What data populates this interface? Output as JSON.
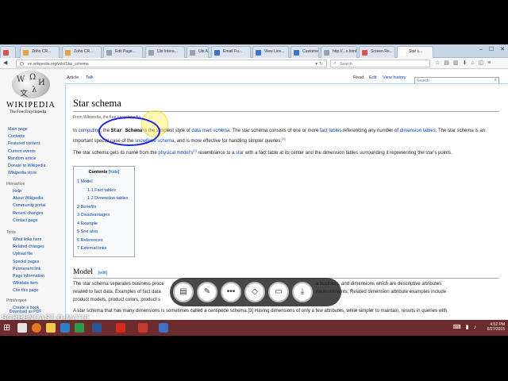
{
  "browser": {
    "tabs": [
      {
        "label": "",
        "color": "#d9534f"
      },
      {
        "label": "Zoho CR...",
        "color": "#e5a33a"
      },
      {
        "label": "Zoho CR...",
        "color": "#e5a33a"
      },
      {
        "label": "Edit Page...",
        "color": "#9aa3ad"
      },
      {
        "label": "Ubi Intera...",
        "color": "#9aa3ad"
      },
      {
        "label": "Ubi Annot...",
        "color": "#9aa3ad"
      },
      {
        "label": "Email Fu...",
        "color": "#3b74c6"
      },
      {
        "label": "View Lice...",
        "color": "#3b74c6"
      },
      {
        "label": "Custome...",
        "color": "#3b74c6"
      },
      {
        "label": "http://...x.html",
        "color": "#9aa3ad"
      },
      {
        "label": "Screen Re...",
        "color": "#d9534f"
      },
      {
        "label": "Star s...",
        "color": "#ffffff"
      }
    ],
    "url": "en.wikipedia.org/wiki/Star_schema",
    "search_placeholder": "Search"
  },
  "wiki": {
    "logo_name": "Wikipedia",
    "logo_tagline": "The Free Encyclopedia",
    "nav_main": [
      "Main page",
      "Contents",
      "Featured content",
      "Current events",
      "Random article",
      "Donate to Wikipedia",
      "Wikipedia store"
    ],
    "interaction_head": "Interaction",
    "nav_interaction": [
      "Help",
      "About Wikipedia",
      "Community portal",
      "Recent changes",
      "Contact page"
    ],
    "tools_head": "Tools",
    "nav_tools": [
      "What links here",
      "Related changes",
      "Upload file",
      "Special pages",
      "Permanent link",
      "Page information",
      "Wikidata item",
      "Cite this page"
    ],
    "print_head": "Print/export",
    "nav_print": [
      "Create a book",
      "Download as PDF"
    ],
    "tab_article": "Article",
    "tab_talk": "Talk",
    "tab_read": "Read",
    "tab_edit": "Edit",
    "tab_history": "View history",
    "search_placeholder": "Search",
    "title": "Star schema",
    "from": "From Wikipedia, the free encyclopedia",
    "intro": {
      "p1_a": "In ",
      "p1_link1": "computing",
      "p1_b": ", the ",
      "p1_term": "Star Schema",
      "p1_c": " is the simplest style of ",
      "p1_link2": "data mart schema",
      "p1_d": ". The star schema consists of one or more ",
      "p1_link3": "fact tables",
      "p1_e": " referencing any number of ",
      "p1_link4": "dimension tables",
      "p1_f": ". The star schema is an important special case of the ",
      "p1_link5": "snowflake schema",
      "p1_g": ", and is more effective for handling simpler queries.",
      "p1_ref": "[1]",
      "p2_a": "The star schema gets its name from the ",
      "p2_link1": "physical model's",
      "p2_ref": "[2]",
      "p2_b": " resemblance to a ",
      "p2_link2": "star",
      "p2_c": " with a fact table at its center and the dimension tables surrounding it representing the star's points."
    },
    "toc": {
      "title": "Contents",
      "hide": "[hide]",
      "items": [
        "1 Model",
        "1.1 Fact tables",
        "1.2 Dimension tables",
        "2 Benefits",
        "3 Disadvantages",
        "4 Example",
        "5 See also",
        "6 References",
        "7 External links"
      ]
    },
    "model_head": "Model",
    "model_edit": "[edit]",
    "model_p1a": "The star schema separates business proce",
    "model_p1b": "a business, and dimensions which are descriptive attributes",
    "model_p2a": "related to fact data. Examples of fact data",
    "model_p2b": "measurements. Related dimension attribute examples include",
    "model_p3a": "product models, product colors, product s",
    "model_p4": "A star schema that has many dimensions is sometimes called a centipede schema.[3] Having dimensions of only a few attributes, while simpler to maintain, results in queries with"
  },
  "annotation_toolbar": {
    "buttons": [
      "toggle-icon",
      "pen-icon",
      "more-icon",
      "eraser-icon",
      "screen-icon",
      "download-icon"
    ]
  },
  "taskbar": {
    "time": "4:52 PM",
    "date": "6/27/2015"
  },
  "watermark": "SCREENCAST-O-MATIC"
}
